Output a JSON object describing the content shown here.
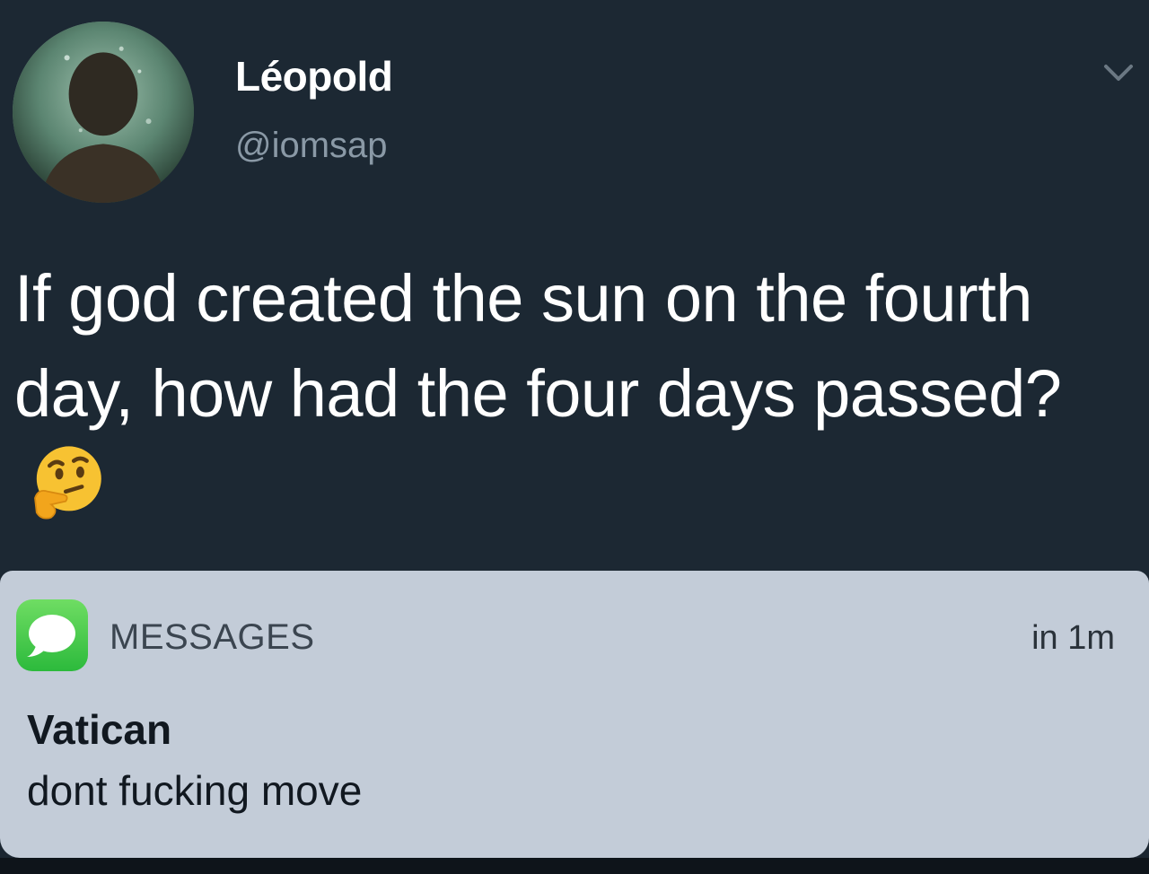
{
  "tweet": {
    "display_name": "Léopold",
    "handle": "@iomsap",
    "text": "If god created the sun on the fourth day, how had the four days passed?",
    "emoji": "thinking-face-icon",
    "menu_icon": "chevron-down-icon"
  },
  "notification": {
    "app_icon": "messages-icon",
    "app_name": "MESSAGES",
    "time": "in 1m",
    "sender": "Vatican",
    "body": "dont fucking move"
  },
  "colors": {
    "tweet_background": "#1c2833",
    "notification_background": "#c3ccd8",
    "messages_green": "#34c759",
    "emoji_yellow": "#f7c232"
  }
}
